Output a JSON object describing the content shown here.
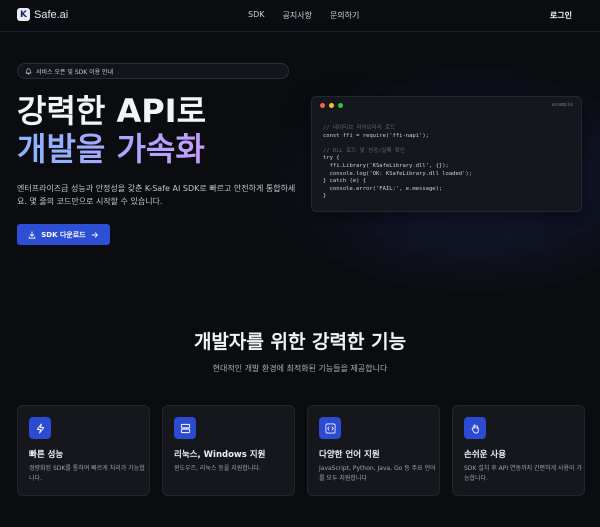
{
  "brand": {
    "name": "Safe.ai",
    "mark": "K"
  },
  "nav": {
    "links": [
      "SDK",
      "공지사항",
      "문의하기"
    ],
    "login": "로그인"
  },
  "notice": {
    "text": "서비스 오픈 및 SDK 이용 안내"
  },
  "hero": {
    "title_line1": "강력한 API로",
    "title_line2": "개발을 가속화",
    "description": "엔터프라이즈급 성능과 안정성을 갖춘 K-Safe AI SDK로 빠르고 안전하게 통합하세요. 몇 줄의 코드만으로 시작할 수 있습니다.",
    "download_label": "SDK 다운로드"
  },
  "code": {
    "filename": "example",
    "lines": [
      {
        "t": "// 네이티브 라이브러리 로드",
        "c": "cm"
      },
      {
        "t": "const ffi = require('ffi-napi');",
        "c": "kw"
      },
      {
        "t": "",
        "c": "kw"
      },
      {
        "t": "// DLL 로드 및 성공/실패 확인",
        "c": "cm"
      },
      {
        "t": "try {",
        "c": "kw"
      },
      {
        "t": "  ffi.Library('KSafeLibrary.dll', {});",
        "c": "kw"
      },
      {
        "t": "  console.log('OK: KSafeLibrary.dll loaded');",
        "c": "kw"
      },
      {
        "t": "} catch (e) {",
        "c": "kw"
      },
      {
        "t": "  console.error('FAIL:', e.message);",
        "c": "kw"
      },
      {
        "t": "}",
        "c": "kw"
      }
    ]
  },
  "features": {
    "title": "개발자를 위한 강력한 기능",
    "subtitle": "현대적인 개발 환경에 최적화된 기능들을 제공합니다",
    "cards": [
      {
        "icon": "lightning-icon",
        "title": "빠른 성능",
        "desc": "경량화된 SDK를 통하여 빠르게 처리가 가능합니다."
      },
      {
        "icon": "server-icon",
        "title": "리눅스, Windows 지원",
        "desc": "윈도우즈, 리눅스 등을 지원합니다."
      },
      {
        "icon": "code-icon",
        "title": "다양한 언어 지원",
        "desc": "JavaScript, Python, Java, Go 등 주요 언어를 모두 지원합니다"
      },
      {
        "icon": "hand-icon",
        "title": "손쉬운 사용",
        "desc": "SDK 설치 후 API 연동까지 간편하게 사용이 가능합니다."
      }
    ]
  },
  "colors": {
    "accent": "#2d4fd3",
    "background": "#0b0c10",
    "card": "#15171d"
  }
}
